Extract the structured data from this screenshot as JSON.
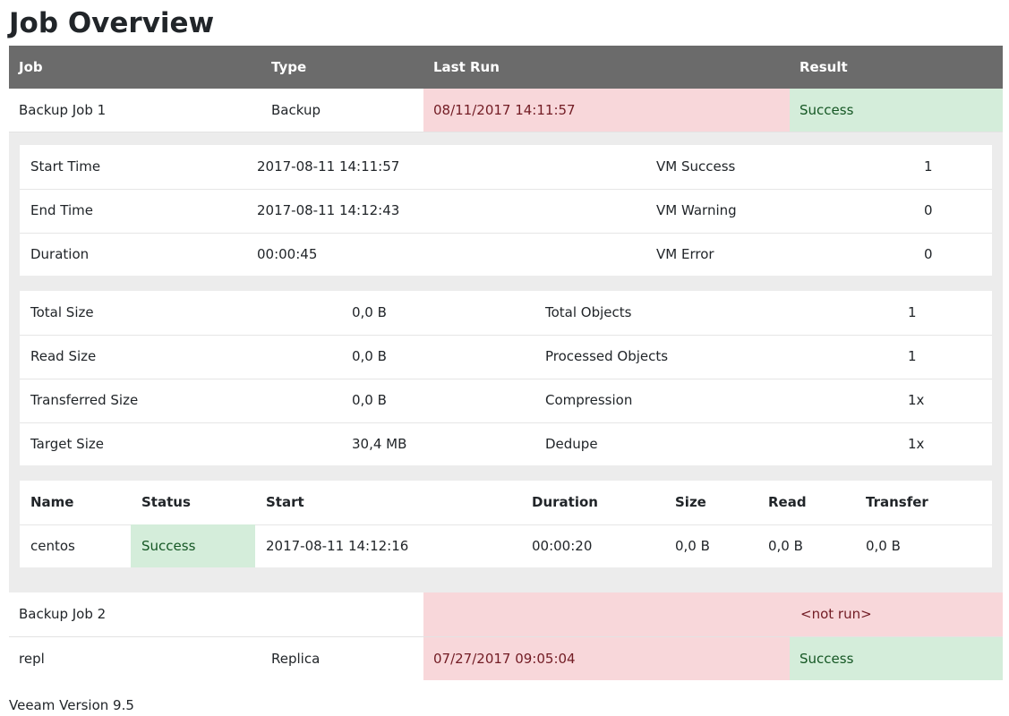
{
  "title": "Job Overview",
  "headers": {
    "job": "Job",
    "type": "Type",
    "last_run": "Last Run",
    "result": "Result"
  },
  "jobs": [
    {
      "name": "Backup Job 1",
      "type": "Backup",
      "last_run": "08/11/2017 14:11:57",
      "result": "Success"
    },
    {
      "name": "Backup Job 2",
      "type": "",
      "last_run": "",
      "result": "<not run>"
    },
    {
      "name": "repl",
      "type": "Replica",
      "last_run": "07/27/2017 09:05:04",
      "result": "Success"
    }
  ],
  "details": {
    "times": [
      {
        "label": "Start Time",
        "value": "2017-08-11 14:11:57",
        "label2": "VM Success",
        "value2": "1"
      },
      {
        "label": "End Time",
        "value": "2017-08-11 14:12:43",
        "label2": "VM Warning",
        "value2": "0"
      },
      {
        "label": "Duration",
        "value": "00:00:45",
        "label2": "VM Error",
        "value2": "0"
      }
    ],
    "sizes": [
      {
        "label": "Total Size",
        "value": "0,0 B",
        "label2": "Total Objects",
        "value2": "1"
      },
      {
        "label": "Read Size",
        "value": "0,0 B",
        "label2": "Processed Objects",
        "value2": "1"
      },
      {
        "label": "Transferred Size",
        "value": "0,0 B",
        "label2": "Compression",
        "value2": "1x"
      },
      {
        "label": "Target Size",
        "value": "30,4 MB",
        "label2": "Dedupe",
        "value2": "1x"
      }
    ],
    "vm_headers": {
      "name": "Name",
      "status": "Status",
      "start": "Start",
      "duration": "Duration",
      "size": "Size",
      "read": "Read",
      "transfer": "Transfer"
    },
    "vms": [
      {
        "name": "centos",
        "status": "Success",
        "start": "2017-08-11 14:12:16",
        "duration": "00:00:20",
        "size": "0,0 B",
        "read": "0,0 B",
        "transfer": "0,0 B"
      }
    ]
  },
  "footer": "Veeam Version 9.5",
  "colors": {
    "header_bg": "#6b6b6b",
    "fail_bg": "#f8d7da",
    "success_bg": "#d4edda",
    "detail_bg": "#ececec"
  }
}
